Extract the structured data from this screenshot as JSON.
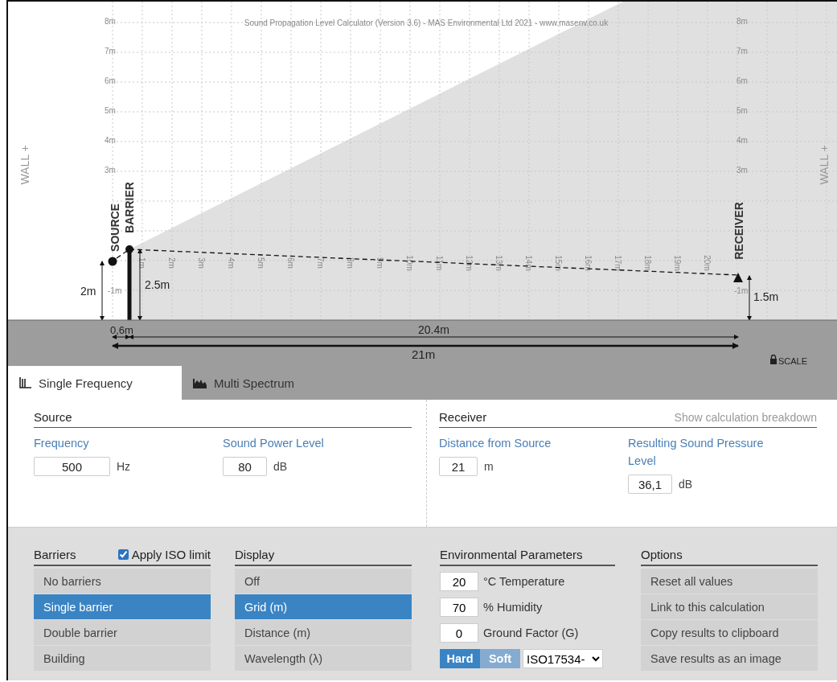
{
  "diagram": {
    "title": "Sound Propagation Level Calculator (Version 3.6) - MAS Environmental Ltd 2021 - www.masenv.co.uk",
    "wall_labels": [
      "WALL +",
      "WALL +"
    ],
    "height_ticks_left": [
      "8m",
      "7m",
      "6m",
      "5m",
      "4m",
      "3m",
      "-1m"
    ],
    "height_ticks_right": [
      "8m",
      "7m",
      "6m",
      "5m",
      "4m",
      "3m",
      "-1m"
    ],
    "distance_ticks": [
      "1m",
      "2m",
      "3m",
      "4m",
      "5m",
      "6m",
      "7m",
      "8m",
      "9m",
      "10m",
      "11m",
      "12m",
      "13m",
      "14m",
      "15m",
      "16m",
      "17m",
      "18m",
      "19m",
      "20m"
    ],
    "source": {
      "label": "SOURCE",
      "height": "2m"
    },
    "barrier": {
      "label": "BARRIER",
      "height": "2.5m"
    },
    "receiver": {
      "label": "RECEIVER",
      "height": "1.5m"
    },
    "distances": {
      "source_to_barrier": "0,6m",
      "barrier_to_receiver": "20.4m",
      "total": "21m"
    },
    "scale": "SCALE"
  },
  "tabs": [
    {
      "label": "Single Frequency",
      "kind": "single",
      "selected": true
    },
    {
      "label": "Multi Spectrum",
      "kind": "spectrum",
      "selected": false
    }
  ],
  "source": {
    "heading": "Source",
    "fields": [
      {
        "label": "Frequency",
        "value": "500",
        "unit": "Hz"
      },
      {
        "label": "Sound Power Level",
        "value": "80",
        "unit": "dB"
      }
    ]
  },
  "receiver": {
    "heading": "Receiver",
    "link": "Show calculation breakdown",
    "fields": [
      {
        "label": "Distance from Source",
        "value": "21",
        "unit": "m"
      },
      {
        "label": "Resulting Sound Pressure Level",
        "value": "36,1",
        "unit": "dB"
      }
    ]
  },
  "barriers": {
    "heading": "Barriers",
    "iso_limit": {
      "label": "Apply ISO limit",
      "checked": true
    },
    "items": [
      {
        "label": "No barriers",
        "selected": false
      },
      {
        "label": "Single barrier",
        "selected": true
      },
      {
        "label": "Double barrier",
        "selected": false
      },
      {
        "label": "Building",
        "selected": false
      }
    ]
  },
  "display": {
    "heading": "Display",
    "items": [
      {
        "label": "Off",
        "selected": false
      },
      {
        "label": "Grid (m)",
        "selected": true
      },
      {
        "label": "Distance (m)",
        "selected": false
      },
      {
        "label": "Wavelength (λ)",
        "selected": false
      }
    ]
  },
  "environment": {
    "heading": "Environmental Parameters",
    "fields": [
      {
        "value": "20",
        "label": "°C Temperature"
      },
      {
        "value": "70",
        "label": "% Humidity"
      },
      {
        "value": "0",
        "label": "Ground Factor (G)"
      }
    ],
    "ground_types": [
      {
        "label": "Hard",
        "selected": true
      },
      {
        "label": "Soft",
        "selected": false
      }
    ],
    "standard": "ISO17534-"
  },
  "options": {
    "heading": "Options",
    "items": [
      "Reset all values",
      "Link to this calculation",
      "Copy results to clipboard",
      "Save results as an image"
    ]
  }
}
